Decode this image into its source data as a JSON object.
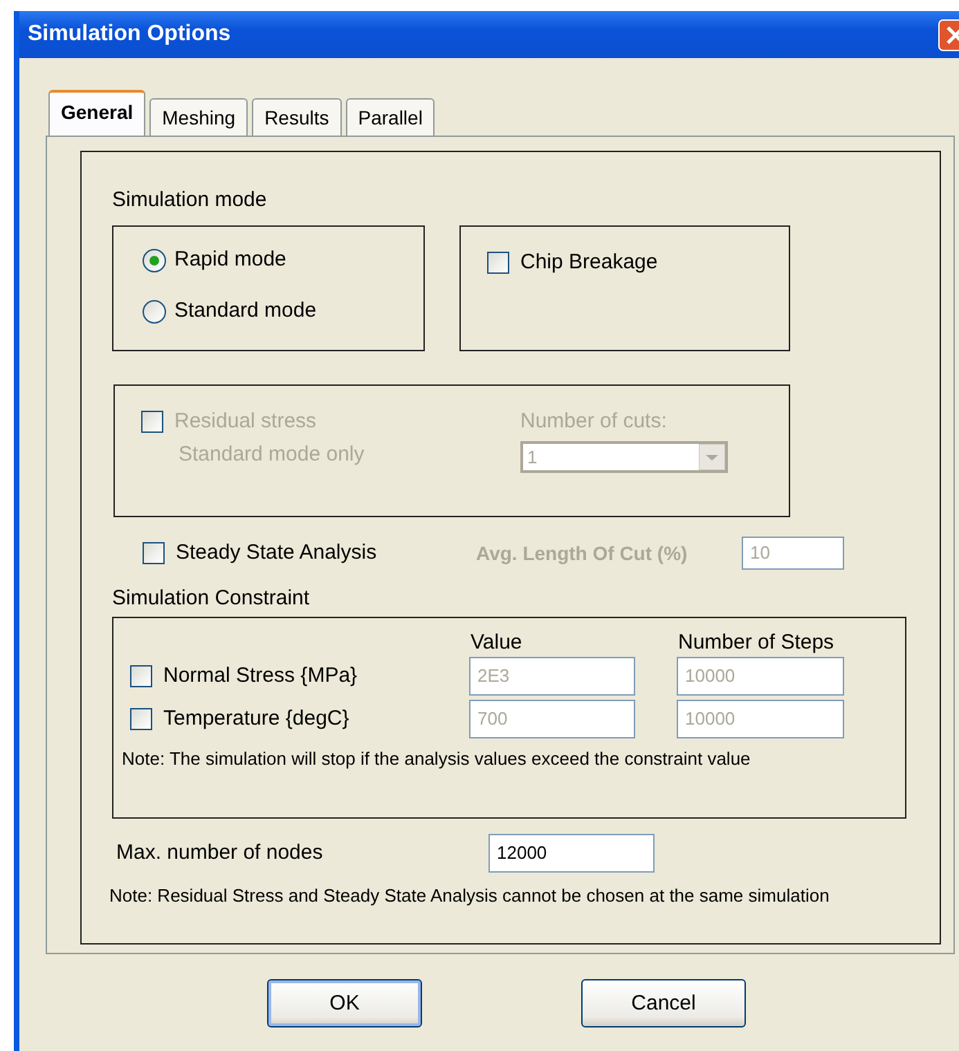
{
  "window": {
    "title": "Simulation Options"
  },
  "tabs": [
    {
      "label": "General",
      "selected": true
    },
    {
      "label": "Meshing",
      "selected": false
    },
    {
      "label": "Results",
      "selected": false
    },
    {
      "label": "Parallel",
      "selected": false
    }
  ],
  "simulation_mode": {
    "label": "Simulation mode",
    "options": [
      {
        "label": "Rapid mode",
        "selected": true
      },
      {
        "label": "Standard mode",
        "selected": false
      }
    ]
  },
  "chip_breakage": {
    "label": "Chip Breakage",
    "checked": false
  },
  "residual_stress": {
    "label": "Residual stress",
    "sublabel": "Standard mode only",
    "checked": false,
    "disabled": true,
    "cuts_label": "Number of cuts:",
    "cuts_value": "1"
  },
  "steady_state": {
    "label": "Steady State Analysis",
    "checked": false,
    "length_label": "Avg. Length Of Cut (%)",
    "length_value": "10",
    "length_disabled": true
  },
  "constraint": {
    "label": "Simulation Constraint",
    "columns": [
      "Value",
      "Number of Steps"
    ],
    "rows": [
      {
        "label": "Normal Stress {MPa}",
        "checked": false,
        "value": "2E3",
        "steps": "10000",
        "disabled": true
      },
      {
        "label": "Temperature {degC}",
        "checked": false,
        "value": "700",
        "steps": "10000",
        "disabled": true
      }
    ],
    "note": "Note: The simulation will stop if the analysis values exceed the constraint value"
  },
  "max_nodes": {
    "label": "Max. number of nodes",
    "value": "12000"
  },
  "note": "Note: Residual Stress and Steady State Analysis cannot be chosen at the same simulation",
  "buttons": [
    {
      "label": "OK",
      "default": true
    },
    {
      "label": "Cancel",
      "default": false
    }
  ]
}
